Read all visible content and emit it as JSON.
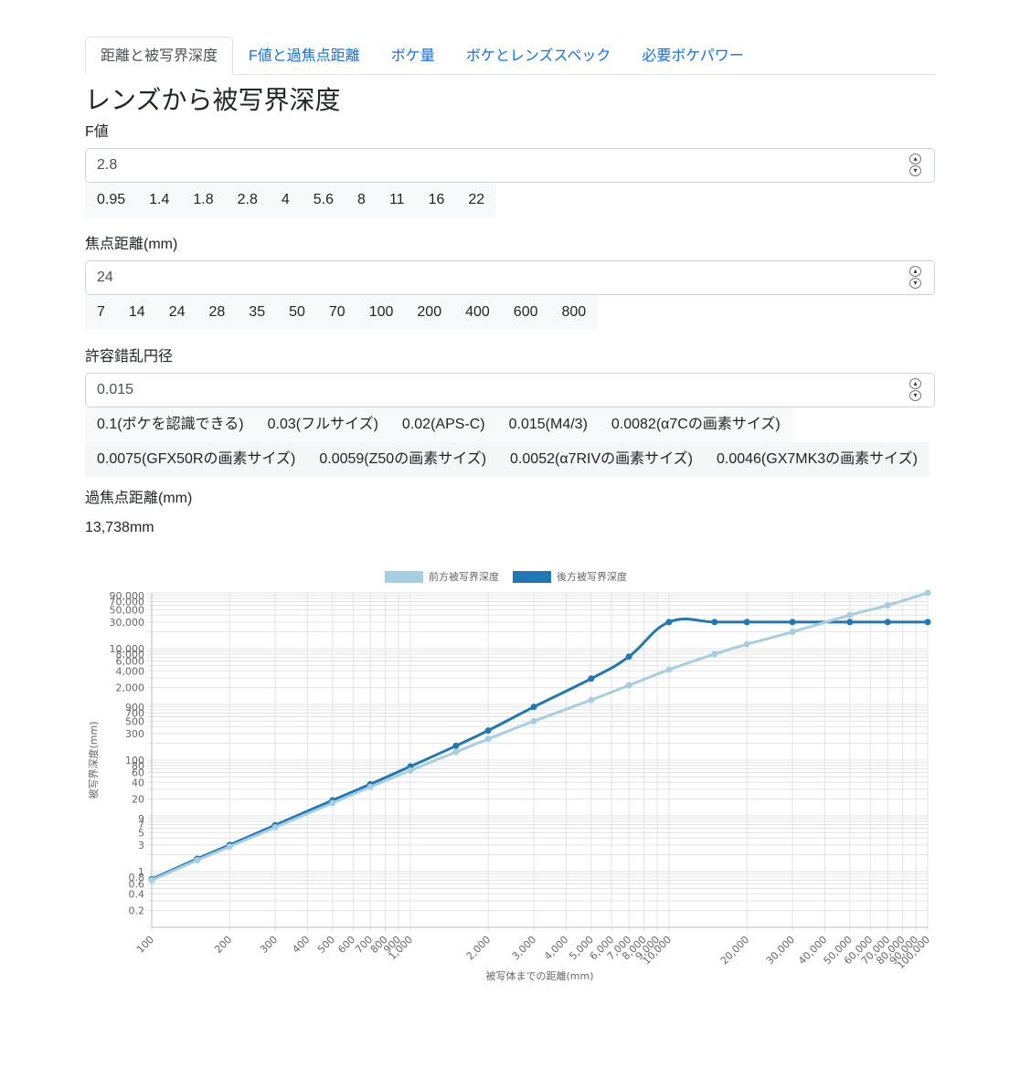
{
  "tabs": [
    {
      "label": "距離と被写界深度",
      "active": true
    },
    {
      "label": "F値と過焦点距離",
      "active": false
    },
    {
      "label": "ボケ量",
      "active": false
    },
    {
      "label": "ボケとレンズスペック",
      "active": false
    },
    {
      "label": "必要ボケパワー",
      "active": false
    }
  ],
  "page_title": "レンズから被写界深度",
  "fnumber": {
    "label": "F値",
    "value": "2.8",
    "presets": [
      "0.95",
      "1.4",
      "1.8",
      "2.8",
      "4",
      "5.6",
      "8",
      "11",
      "16",
      "22"
    ]
  },
  "focal": {
    "label": "焦点距離(mm)",
    "value": "24",
    "presets": [
      "7",
      "14",
      "24",
      "28",
      "35",
      "50",
      "70",
      "100",
      "200",
      "400",
      "600",
      "800"
    ]
  },
  "coc": {
    "label": "許容錯乱円径",
    "value": "0.015",
    "presets_row1": [
      "0.1(ボケを認識できる)",
      "0.03(フルサイズ)",
      "0.02(APS-C)",
      "0.015(M4/3)",
      "0.0082(α7Cの画素サイズ)"
    ],
    "presets_row2": [
      "0.0075(GFX50Rの画素サイズ)",
      "0.0059(Z50の画素サイズ)",
      "0.0052(α7RIVの画素サイズ)",
      "0.0046(GX7MK3の画素サイズ)"
    ]
  },
  "hyperfocal": {
    "label": "過焦点距離(mm)",
    "value": "13,738mm"
  },
  "colors": {
    "link": "#0d6efd",
    "front_series": "#a6cee3",
    "back_series": "#1f78b4"
  },
  "chart_data": {
    "type": "line",
    "xlabel": "被写体までの距離(mm)",
    "ylabel": "被写界深度(mm)",
    "x_scale": "log",
    "y_scale": "log",
    "xlim": [
      100,
      100000
    ],
    "ylim": [
      0.1,
      100000
    ],
    "grid": true,
    "legend_position": "top",
    "x_tick_labels": [
      "100",
      "200",
      "300",
      "400",
      "500",
      "600",
      "700",
      "800",
      "900",
      "1,000",
      "2,000",
      "3,000",
      "4,000",
      "5,000",
      "6,000",
      "7,000",
      "8,000",
      "9,000",
      "10,000",
      "20,000",
      "30,000",
      "40,000",
      "50,000",
      "60,000",
      "70,000",
      "80,000",
      "90,000",
      "100,000"
    ],
    "y_tick_labels": [
      "0.2",
      "0.4",
      "0.6",
      "0.8",
      "1",
      "3",
      "5",
      "7",
      "9",
      "20",
      "40",
      "60",
      "80",
      "100",
      "300",
      "500",
      "700",
      "900",
      "2,000",
      "4,000",
      "6,000",
      "8,000",
      "10,000",
      "30,000",
      "50,000",
      "70,000",
      "90,000"
    ],
    "x": [
      100,
      150,
      200,
      300,
      500,
      700,
      1000,
      1500,
      2000,
      3000,
      5000,
      7000,
      10000,
      15000,
      20000,
      30000,
      50000,
      70000,
      100000
    ],
    "series": [
      {
        "name": "前方被写界深度",
        "values": [
          0.7,
          1.6,
          2.8,
          6.2,
          17,
          33,
          65,
          140,
          240,
          500,
          1200,
          2200,
          4200,
          8000,
          12000,
          20000,
          40000,
          60000,
          100000
        ]
      },
      {
        "name": "後方被写界深度",
        "values": [
          0.73,
          1.7,
          3.0,
          6.8,
          19,
          37,
          77,
          180,
          340,
          900,
          2900,
          7200,
          30000,
          30000,
          30000,
          30000,
          30000,
          30000,
          30000
        ]
      }
    ]
  }
}
